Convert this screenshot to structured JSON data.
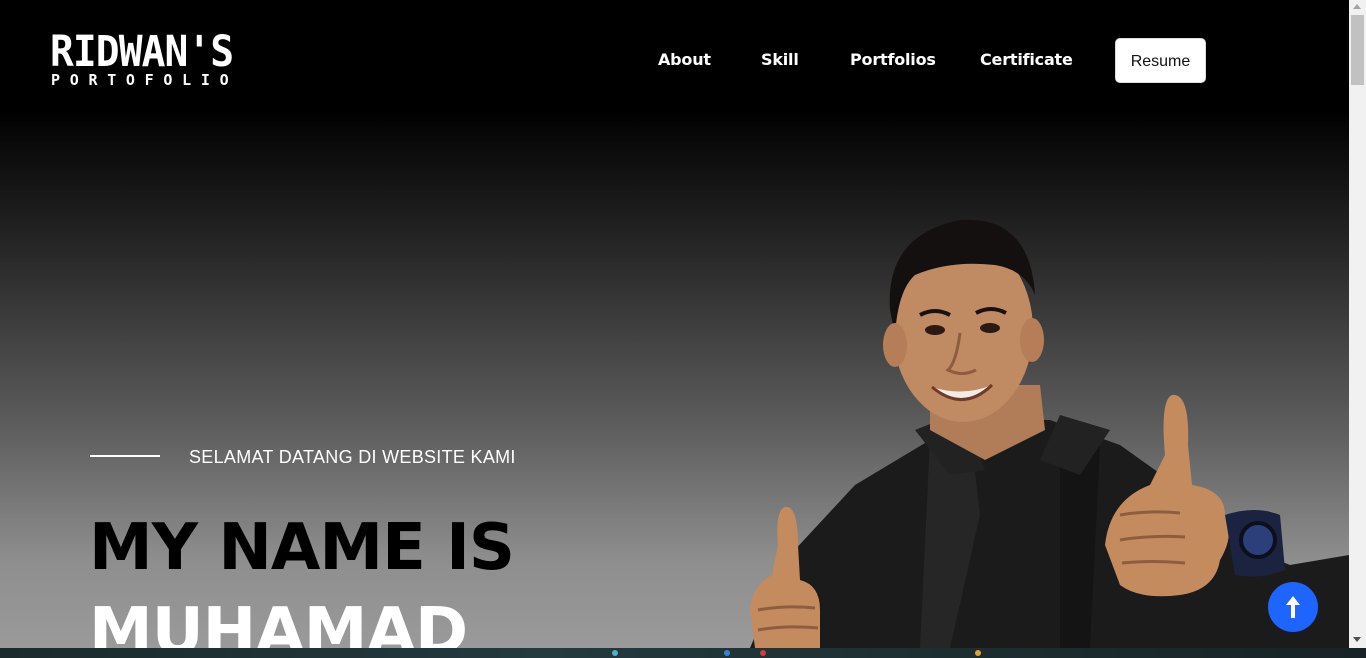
{
  "header": {
    "logo": {
      "line1": "RIDWAN'S",
      "line2": "PORTOFOLIO"
    },
    "nav": [
      {
        "label": "About"
      },
      {
        "label": "Skill"
      },
      {
        "label": "Portfolios"
      },
      {
        "label": "Certificate"
      }
    ],
    "resume_label": "Resume"
  },
  "hero": {
    "subtitle": "SELAMAT DATANG DI WEBSITE KAMI",
    "title_line1": "MY NAME IS",
    "title_line2": "MUHAMAD"
  },
  "icons": {
    "scroll_top": "arrow-up-icon",
    "scrollbar_up": "chevron-up-icon",
    "scrollbar_down": "chevron-down-icon"
  },
  "colors": {
    "accent": "#1e64ff",
    "background": "#000000",
    "resume_bg": "#ffffff"
  }
}
